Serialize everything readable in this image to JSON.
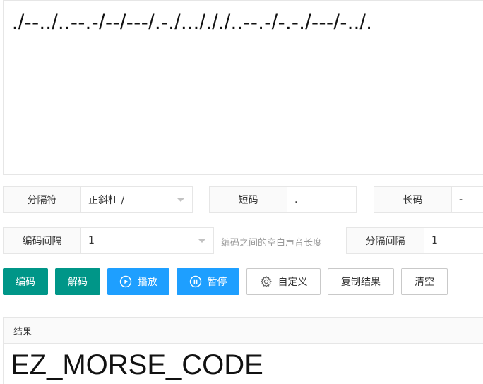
{
  "input": {
    "morse_text": "./--../..--.-/--/---/.-./.../././..--.-/-.-./---/-../."
  },
  "controls": {
    "separator": {
      "label": "分隔符",
      "value": "正斜杠 /"
    },
    "short_code": {
      "label": "短码",
      "value": "."
    },
    "long_code": {
      "label": "长码",
      "value": "-"
    },
    "code_interval": {
      "label": "编码间隔",
      "value": "1",
      "hint": "编码之间的空白声音长度"
    },
    "separator_interval": {
      "label": "分隔间隔",
      "value": "1"
    }
  },
  "buttons": {
    "encode": "编码",
    "decode": "解码",
    "play": "播放",
    "pause": "暂停",
    "custom": "自定义",
    "copy": "复制结果",
    "clear": "清空"
  },
  "result": {
    "title": "结果",
    "value": "EZ_MORSE_CODE"
  },
  "colors": {
    "green": "#009688",
    "blue": "#1e9fff"
  }
}
